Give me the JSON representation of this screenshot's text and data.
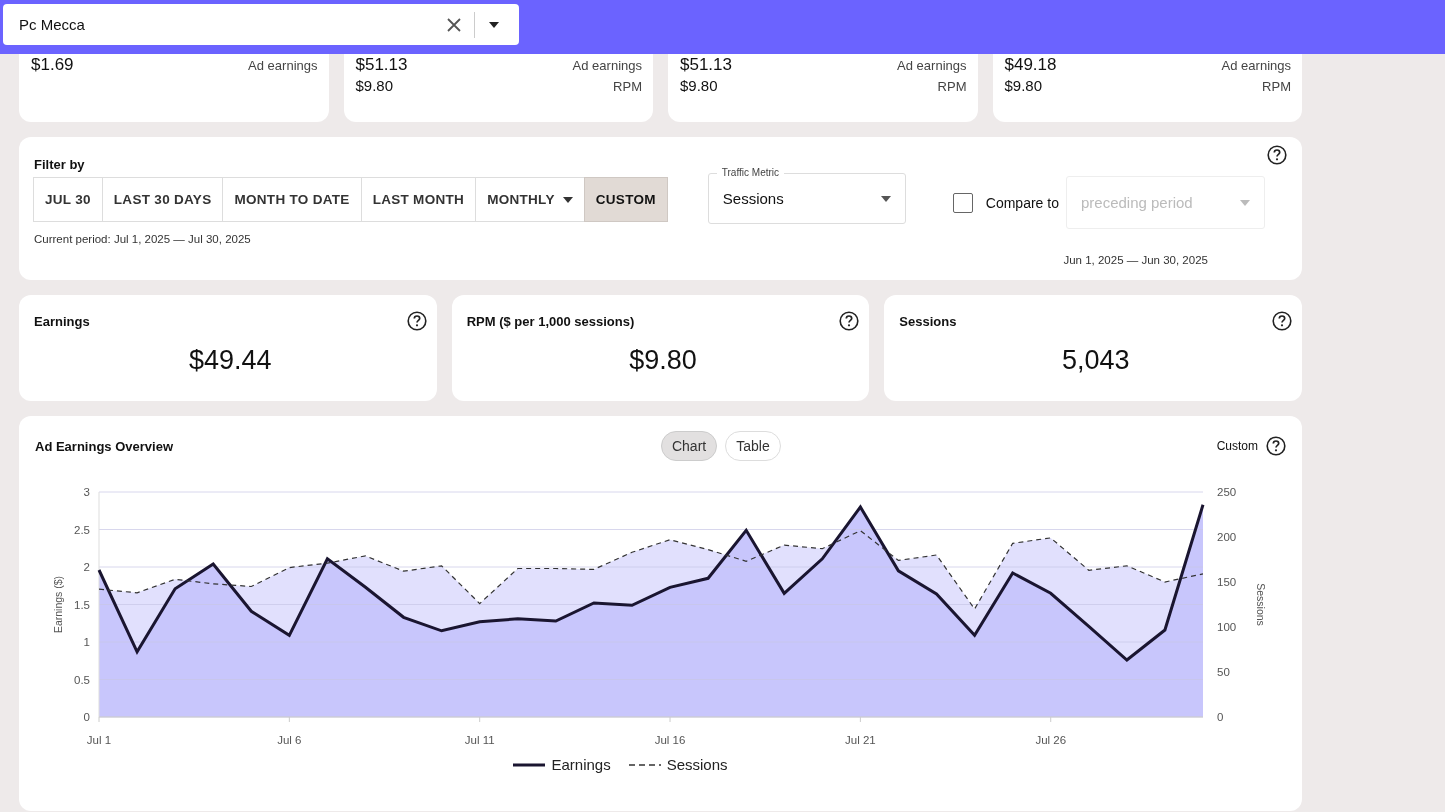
{
  "site_selector": {
    "value": "Pc Mecca"
  },
  "summary_cards": [
    {
      "rows": [
        {
          "value": "$1.69",
          "label": "Ad earnings"
        }
      ]
    },
    {
      "rows": [
        {
          "value": "$51.13",
          "label": "Ad earnings"
        },
        {
          "value": "$9.80",
          "label": "RPM"
        }
      ]
    },
    {
      "rows": [
        {
          "value": "$51.13",
          "label": "Ad earnings"
        },
        {
          "value": "$9.80",
          "label": "RPM"
        }
      ]
    },
    {
      "rows": [
        {
          "value": "$49.18",
          "label": "Ad earnings"
        },
        {
          "value": "$9.80",
          "label": "RPM"
        }
      ]
    }
  ],
  "filter": {
    "title": "Filter by",
    "buttons": [
      {
        "label": "JUL 30",
        "selected": false,
        "dropdown": false
      },
      {
        "label": "LAST 30 DAYS",
        "selected": false,
        "dropdown": false
      },
      {
        "label": "MONTH TO DATE",
        "selected": false,
        "dropdown": false
      },
      {
        "label": "LAST MONTH",
        "selected": false,
        "dropdown": false
      },
      {
        "label": "MONTHLY",
        "selected": false,
        "dropdown": true
      },
      {
        "label": "CUSTOM",
        "selected": true,
        "dropdown": false
      }
    ],
    "current_period": "Current period: Jul 1, 2025 — Jul 30, 2025",
    "traffic_metric": {
      "label": "Traffic Metric",
      "value": "Sessions"
    },
    "compare": {
      "label": "Compare to",
      "checked": false,
      "placeholder": "preceding period",
      "period": "Jun 1, 2025 — Jun 30, 2025"
    }
  },
  "metrics": [
    {
      "title": "Earnings",
      "value": "$49.44"
    },
    {
      "title": "RPM ($ per 1,000 sessions)",
      "value": "$9.80"
    },
    {
      "title": "Sessions",
      "value": "5,043"
    }
  ],
  "overview": {
    "title": "Ad Earnings Overview",
    "view_toggle": [
      {
        "label": "Chart",
        "selected": true
      },
      {
        "label": "Table",
        "selected": false
      }
    ],
    "range_label": "Custom",
    "chart_data": {
      "type": "area",
      "grid": true,
      "legend": "bottom",
      "ylabel": "Earnings ($)",
      "y2label": "Sessions",
      "categories": [
        "Jul 1",
        null,
        null,
        null,
        null,
        "Jul 6",
        null,
        null,
        null,
        null,
        "Jul 11",
        null,
        null,
        null,
        null,
        "Jul 16",
        null,
        null,
        null,
        null,
        "Jul 21",
        null,
        null,
        null,
        null,
        "Jul 26",
        null,
        null,
        null,
        null
      ],
      "ylim": [
        0,
        3
      ],
      "yticks": [
        0,
        0.5,
        1,
        1.5,
        2,
        2.5,
        3
      ],
      "y2lim": [
        0,
        250
      ],
      "y2ticks": [
        0,
        50,
        100,
        150,
        200,
        250
      ],
      "series": [
        {
          "name": "Earnings",
          "color": "#1a1530",
          "line_style": "solid",
          "values": [
            1.96,
            0.87,
            1.71,
            2.04,
            1.41,
            1.09,
            2.11,
            1.73,
            1.33,
            1.15,
            1.27,
            1.31,
            1.28,
            1.52,
            1.49,
            1.73,
            1.85,
            2.49,
            1.65,
            2.11,
            2.8,
            1.95,
            1.64,
            1.09,
            1.92,
            1.65,
            1.21,
            0.76,
            1.16,
            2.83
          ]
        },
        {
          "name": "Sessions",
          "color": "#333333",
          "line_style": "dashed",
          "axis": "y2",
          "values": [
            142,
            138,
            153,
            148,
            145,
            166,
            171,
            179,
            162,
            168,
            126,
            165,
            165,
            164,
            183,
            197,
            186,
            173,
            191,
            187,
            207,
            174,
            180,
            120,
            193,
            199,
            163,
            168,
            150,
            159
          ]
        }
      ]
    }
  }
}
